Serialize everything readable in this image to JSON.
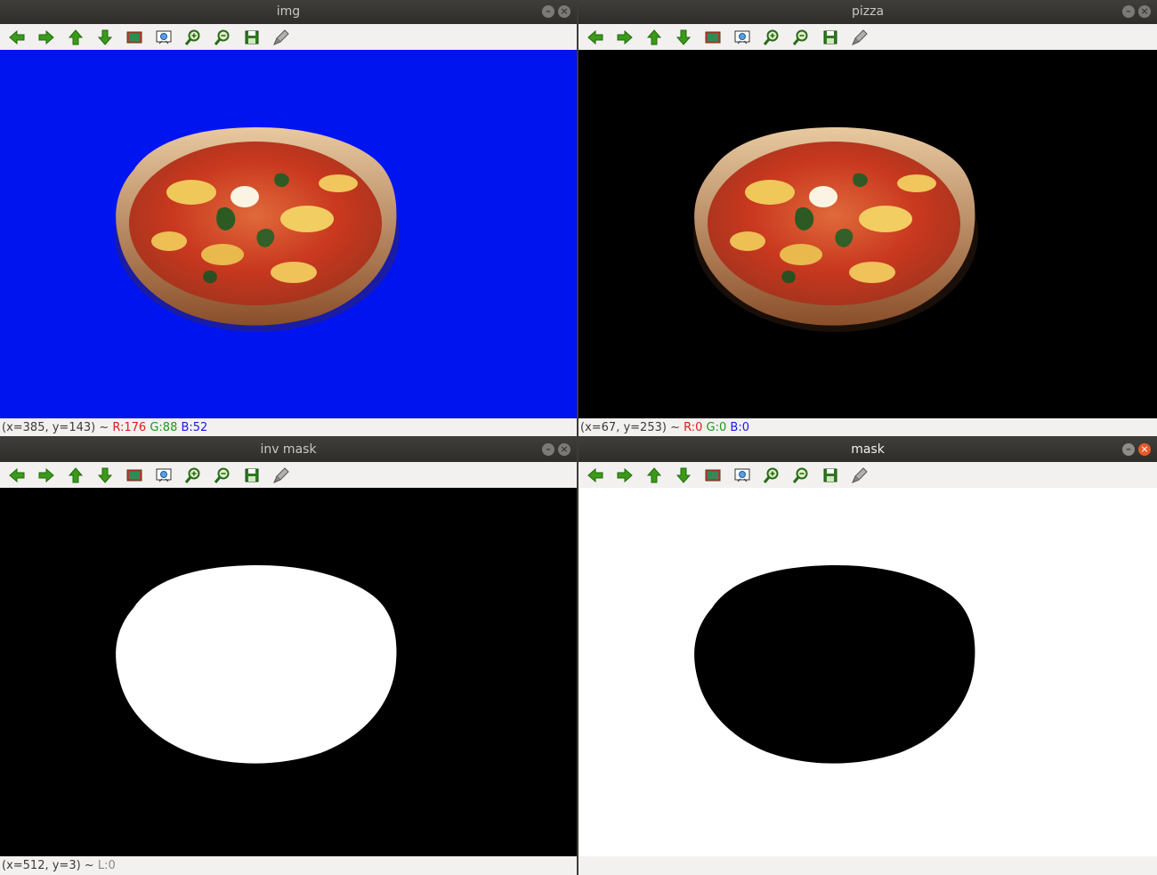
{
  "windows": {
    "img": {
      "title": "img",
      "status": {
        "coords": "(x=385, y=143) ~ ",
        "r": "R:176",
        "g": "G:88",
        "b": "B:52"
      }
    },
    "pizza": {
      "title": "pizza",
      "status": {
        "coords": "(x=67, y=253) ~ ",
        "r": "R:0",
        "g": "G:0",
        "b": "B:0"
      }
    },
    "inv_mask": {
      "title": "inv mask",
      "status": {
        "coords": "(x=512, y=3) ~ ",
        "l": "L:0"
      }
    },
    "mask": {
      "title": "mask",
      "status": {
        "coords": "",
        "l": ""
      }
    }
  },
  "toolbar_icons": [
    "pan-left-icon",
    "pan-right-icon",
    "pan-up-icon",
    "pan-down-icon",
    "zoom-original-icon",
    "zoom-fit-icon",
    "zoom-in-icon",
    "zoom-out-icon",
    "save-icon",
    "properties-icon"
  ],
  "window_buttons": {
    "minimize": "–",
    "close": "×"
  },
  "colors": {
    "blue_bg": "#0014f0",
    "black": "#000000",
    "white": "#ffffff"
  }
}
